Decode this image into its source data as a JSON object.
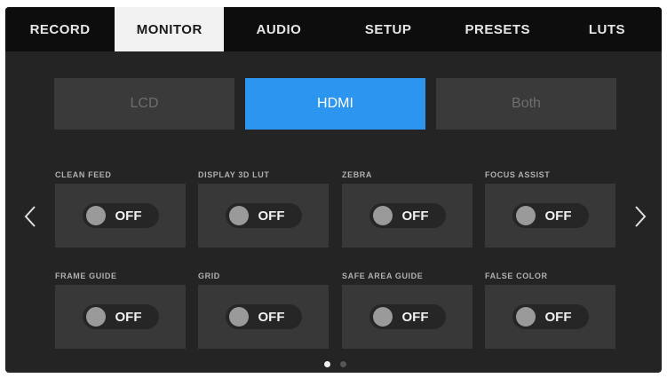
{
  "tabs": [
    {
      "label": "RECORD"
    },
    {
      "label": "MONITOR"
    },
    {
      "label": "AUDIO"
    },
    {
      "label": "SETUP"
    },
    {
      "label": "PRESETS"
    },
    {
      "label": "LUTS"
    }
  ],
  "active_tab": "MONITOR",
  "output_selector": {
    "options": [
      "LCD",
      "HDMI",
      "Both"
    ],
    "selected": "HDMI"
  },
  "settings": [
    {
      "label": "CLEAN FEED",
      "value": "OFF"
    },
    {
      "label": "DISPLAY 3D LUT",
      "value": "OFF"
    },
    {
      "label": "ZEBRA",
      "value": "OFF"
    },
    {
      "label": "FOCUS ASSIST",
      "value": "OFF"
    },
    {
      "label": "FRAME GUIDE",
      "value": "OFF"
    },
    {
      "label": "GRID",
      "value": "OFF"
    },
    {
      "label": "SAFE AREA GUIDE",
      "value": "OFF"
    },
    {
      "label": "FALSE COLOR",
      "value": "OFF"
    }
  ],
  "pagination": {
    "current_page": 1,
    "total_pages": 2
  },
  "colors": {
    "accent": "#2b95f0",
    "background": "#242424"
  },
  "icons": {
    "prev": "chevron-left-icon",
    "next": "chevron-right-icon"
  }
}
